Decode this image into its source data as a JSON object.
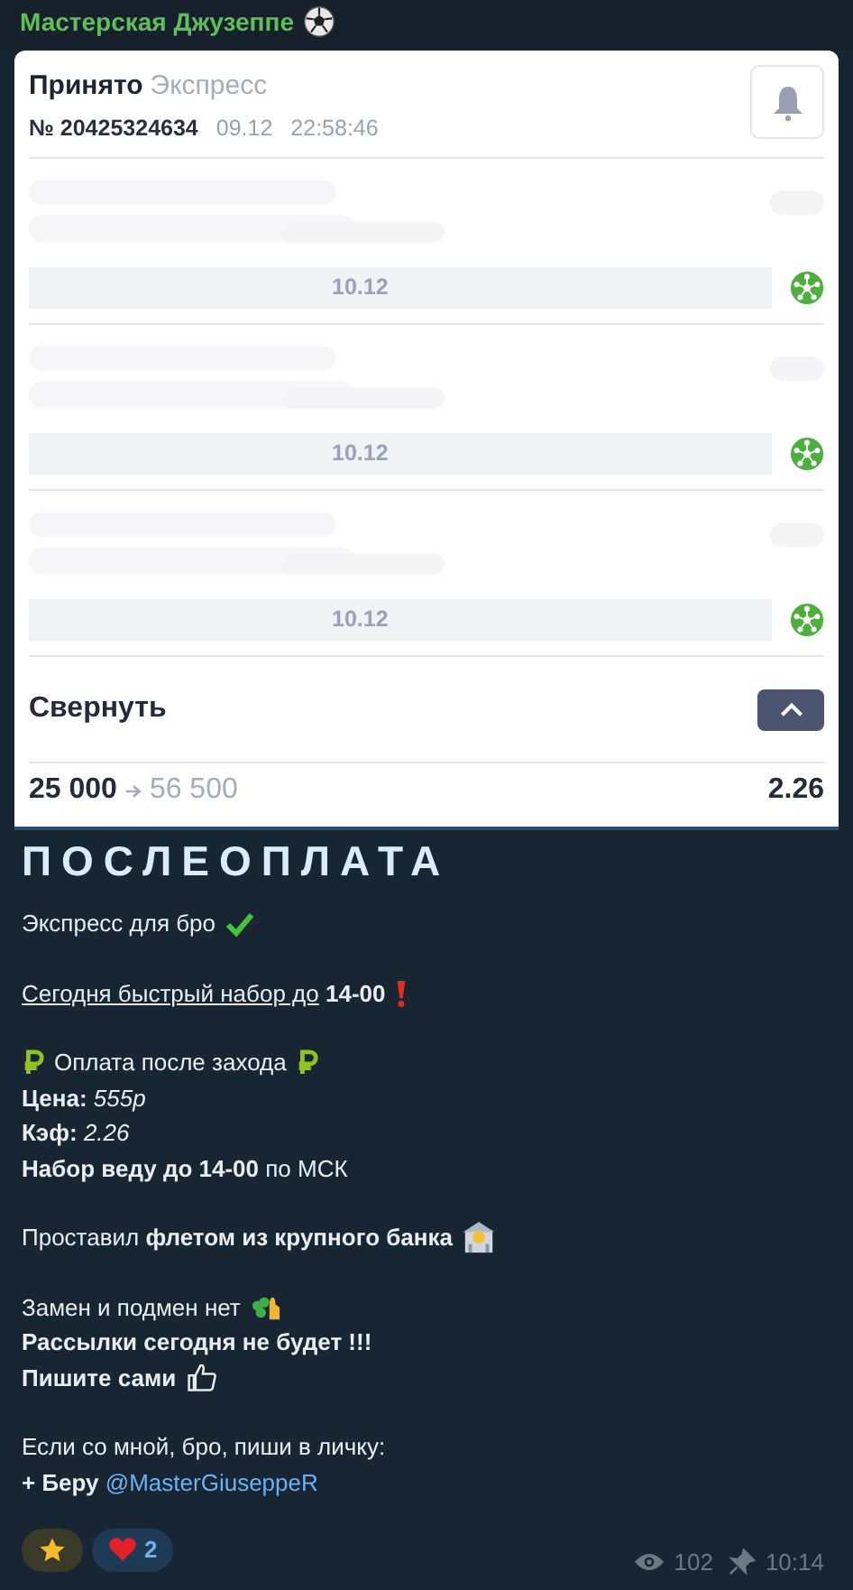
{
  "channel": {
    "name": "Мастерская Джузеппе"
  },
  "bet": {
    "status": "Принято",
    "type": "Экспресс",
    "number": "№ 20425324634",
    "date": "09.12",
    "time": "22:58:46",
    "events": [
      {
        "date": "10.12"
      },
      {
        "date": "10.12"
      },
      {
        "date": "10.12"
      }
    ],
    "collapse_label": "Свернуть",
    "expanded": true,
    "stake": "25 000",
    "payout": "56 500",
    "odds": "2.26"
  },
  "post": {
    "title": "ПОСЛЕОПЛАТА",
    "paragraphs": [
      {
        "lines": [
          {
            "bold": false,
            "text": "Экспресс для бро"
          }
        ]
      },
      {
        "lines": [
          {
            "bold": false,
            "underlined": "Сегодня быстрый набор до",
            "text": " **14-00**"
          }
        ]
      },
      {
        "lines": [
          {
            "bold": false,
            "text": "Оплата после захода"
          },
          {
            "bold": false,
            "text": "**Цена:** *555р*"
          },
          {
            "bold": false,
            "text": "**Кэф:** *2.26*"
          },
          {
            "bold": false,
            "text": "**Набор веду до 14-00** по МСК"
          }
        ]
      },
      {
        "lines": [
          {
            "bold": false,
            "text": "Проставил **флетом из крупного банка**"
          }
        ]
      },
      {
        "lines": [
          {
            "bold": false,
            "text": "Замен и подмен нет"
          },
          {
            "bold": true,
            "text": "Рассылки сегодня не будет !!!"
          },
          {
            "bold": true,
            "text": "Пишите сами"
          }
        ]
      },
      {
        "lines": [
          {
            "bold": false,
            "text": "Если со мной, бро, пиши в личку:"
          },
          {
            "bold": false,
            "text": "**+ Беру** ",
            "link": "@MasterGiuseppeR"
          }
        ]
      }
    ]
  },
  "reactions": [
    {
      "kind": "star"
    },
    {
      "kind": "heart",
      "count": "2"
    }
  ],
  "views": "102",
  "pinned": true,
  "time": "10:14"
}
